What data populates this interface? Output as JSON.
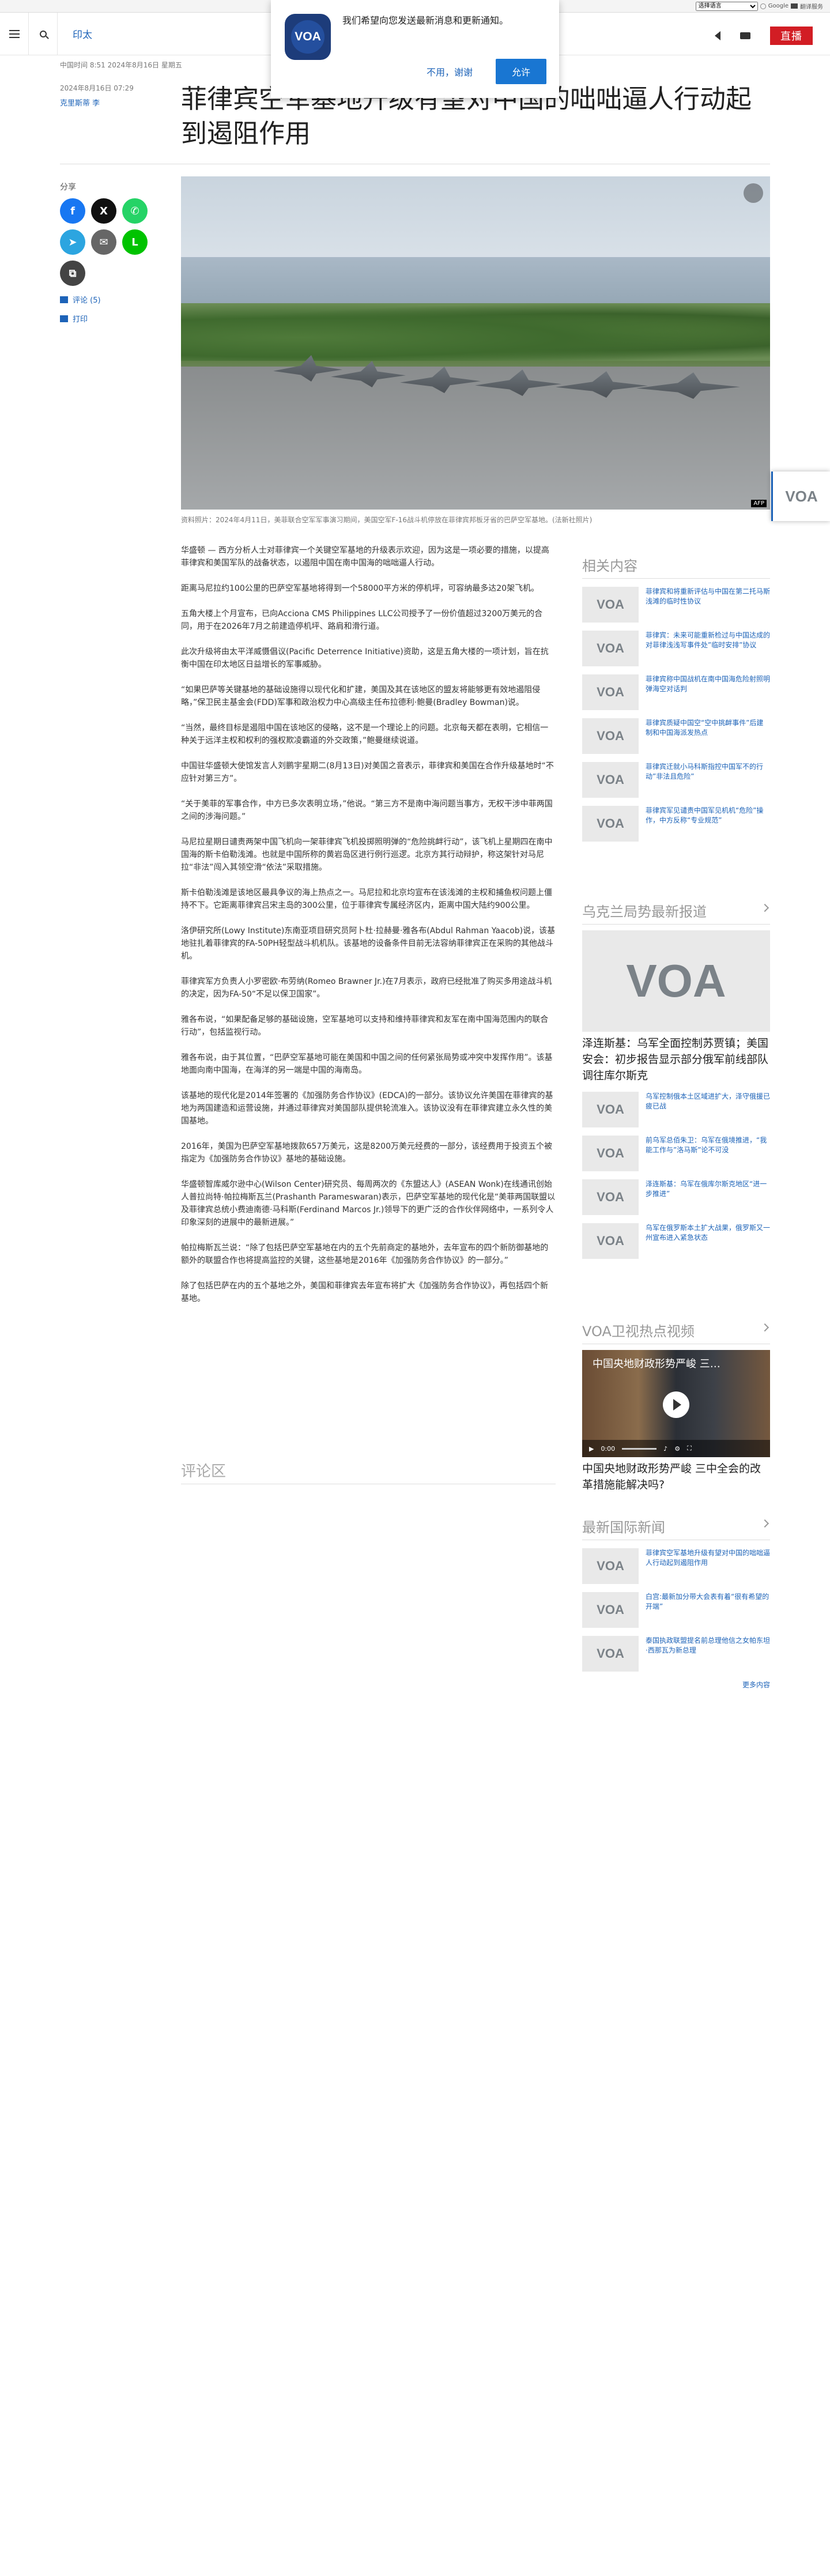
{
  "topbar": {
    "lang_select": "选择语言",
    "google": "Google",
    "translate": "翻译服务"
  },
  "header": {
    "section": "印太",
    "live": "直播"
  },
  "popup": {
    "logo": "VOA",
    "message": "我们希望向您发送最新消息和更新通知。",
    "no": "不用，谢谢",
    "yes": "允许"
  },
  "meta": {
    "line1": "中国时间 8:51 2024年8月16日 星期五",
    "line2": "2024年8月16日 07:29",
    "author": "克里斯蒂 李"
  },
  "title": "菲律宾空军基地升级有望对中国的咄咄逼人行动起到遏阻作用",
  "share": {
    "label": "分享",
    "comments": "评论 (5)",
    "print": "打印"
  },
  "photo": {
    "credit": "AFP",
    "caption": "资料照片：2024年4月11日，美菲联合空军军事演习期间，美国空军F-16战斗机停放在菲律宾邦板牙省的巴萨空军基地。(法新社照片)"
  },
  "article": [
    "华盛顿 — 西方分析人士对菲律宾一个关键空军基地的升级表示欢迎，因为这是一项必要的措施，以提高菲律宾和美国军队的战备状态，以遏阻中国在南中国海的咄咄逼人行动。",
    "距离马尼拉约100公里的巴萨空军基地将得到一个58000平方米的停机坪，可容纳最多达20架飞机。",
    "五角大楼上个月宣布，已向Acciona CMS Philippines LLC公司授予了一份价值超过3200万美元的合同，用于在2026年7月之前建造停机坪、路肩和滑行道。",
    "此次升级将由太平洋威慑倡议(Pacific Deterrence Initiative)资助，这是五角大楼的一项计划，旨在抗衡中国在印太地区日益增长的军事威胁。",
    "“如果巴萨等关键基地的基础设施得以现代化和扩建，美国及其在该地区的盟友将能够更有效地遏阻侵略，”保卫民主基金会(FDD)军事和政治权力中心高级主任布拉德利·鲍曼(Bradley Bowman)说。",
    "“当然，最终目标是遏阻中国在该地区的侵略，这不是一个理论上的问题。北京每天都在表明，它相信一种关于远洋主权和权利的强权欺凌霸道的外交政策，”鲍曼继续说道。",
    "中国驻华盛顿大使馆发言人刘鹏宇星期二(8月13日)对美国之音表示，菲律宾和美国在合作升级基地时“不应针对第三方”。",
    "“关于美菲的军事合作，中方已多次表明立场，”他说。“第三方不是南中海问题当事方，无权干涉中菲两国之间的涉海问题。”",
    "马尼拉星期日谴责两架中国飞机向一架菲律宾飞机投掷照明弹的“危险挑衅行动”，该飞机上星期四在南中国海的斯卡伯勒浅滩。也就是中国所称的黄岩岛区进行例行巡逻。北京方其行动辩护，称这架针对马尼拉“非法”闯入其领空滑“依法”采取措施。",
    "斯卡伯勒浅滩是该地区最具争议的海上热点之一。马尼拉和北京均宣布在该浅滩的主权和捕鱼权问题上僵持不下。它距离菲律宾吕宋主岛的300公里，位于菲律宾专属经济区内，距离中国大陆约900公里。",
    "洛伊研究所(Lowy Institute)东南亚项目研究员阿卜杜·拉赫曼·雅各布(Abdul Rahman Yaacob)说，该基地驻扎着菲律宾的FA-50PH轻型战斗机机队。该基地的设备条件目前无法容纳菲律宾正在采购的其他战斗机。",
    "菲律宾军方负责人小罗密欧·布劳纳(Romeo Brawner Jr.)在7月表示，政府已经批准了购买多用途战斗机的决定，因为FA-50“不足以保卫国家”。",
    "雅各布说，“如果配备足够的基础设施，空军基地可以支持和维持菲律宾和友军在南中国海范围内的联合行动”，包括监视行动。",
    "雅各布说，由于其位置，“巴萨空军基地可能在美国和中国之间的任何紧张局势或冲突中发挥作用”。该基地面向南中国海，在海洋的另一端是中国的海南岛。",
    "该基地的现代化是2014年签署的《加强防务合作协议》(EDCA)的一部分。该协议允许美国在菲律宾的基地为两国建造和运营设施，并通过菲律宾对美国部队提供轮流准入。该协议没有在菲律宾建立永久性的美国基地。",
    "2016年，美国为巴萨空军基地拨款657万美元，这是8200万美元经费的一部分，该经费用于投资五个被指定为《加强防务合作协议》基地的基础设施。",
    "华盛顿智库威尔逊中心(Wilson Center)研究员、每周两次的《东盟达人》(ASEAN Wonk)在线通讯创始人普拉尚特·帕拉梅斯瓦兰(Prashanth Parameswaran)表示，巴萨空军基地的现代化是“美菲两国联盟以及菲律宾总统小费迪南德·马科斯(Ferdinand Marcos Jr.)领导下的更广泛的合作伙伴网络中，一系列令人印象深刻的进展中的最新进展。”",
    "帕拉梅斯瓦兰说：“除了包括巴萨空军基地在内的五个先前商定的基地外，去年宣布的四个新防御基地的额外的联盟合作也将提高监控的关键，这些基地是2016年《加强防务合作协议》的一部分。”",
    "除了包括巴萨在内的五个基地之外，美国和菲律宾去年宣布将扩大《加强防务合作协议》，再包括四个新基地。"
  ],
  "comments_label": "评论区",
  "related": {
    "title": "相关内容",
    "items": [
      "菲律宾和将重新评估与中国在第二托马斯浅滩的临时性协议",
      "菲律宾：未来可能重新检过与中国达成的对菲律浅浅写事件处”临时安排”协议",
      "菲律宾称中国战机在南中国海危险射照明弹海空对话判",
      "菲律宾质疑中国空“空中挑衅事件”后建制和中国海派发热点",
      "菲律宾迁就小马科斯指控中国军不的行动”非法且危险”",
      "菲律宾军见谴责中国军见机机“危险”操作，中方反称“专业规范”"
    ]
  },
  "ukraine": {
    "title": "乌克兰局势最新报道",
    "lead": "泽连斯基：乌军全面控制苏贾镇；美国安会：初步报告显示部分俄军前线部队调往库尔斯克",
    "items": [
      "乌军控制俄本土区域进扩大，泽守俄援已疲已战",
      "前乌军总佰朱卫：乌军在俄境推进，“我能工作与”洛马斯”论不可没",
      "泽连斯基：乌军在俄库尔斯克地区“进一步推进”",
      "乌军在俄罗斯本土扩大战果，俄罗斯又一州宣布进入紧急状态"
    ]
  },
  "voa_tv": {
    "title": "VOA卫视热点视频",
    "video_overlay": "中国央地财政形势严峻 三…",
    "caption": "中国央地财政形势严峻 三中全会的改革措施能解决吗?",
    "time": "0:00"
  },
  "world": {
    "title": "最新国际新闻",
    "items": [
      "菲律宾空军基地升级有望对中国的咄咄逼人行动起到遏阻作用",
      "白宫:最新加分带大会表有着“很有希望的开端”",
      "泰国执政联盟提名前总理他信之女帕东坦·西那瓦为新总理"
    ],
    "more": "更多内容"
  },
  "thumb_logo": "VOA"
}
